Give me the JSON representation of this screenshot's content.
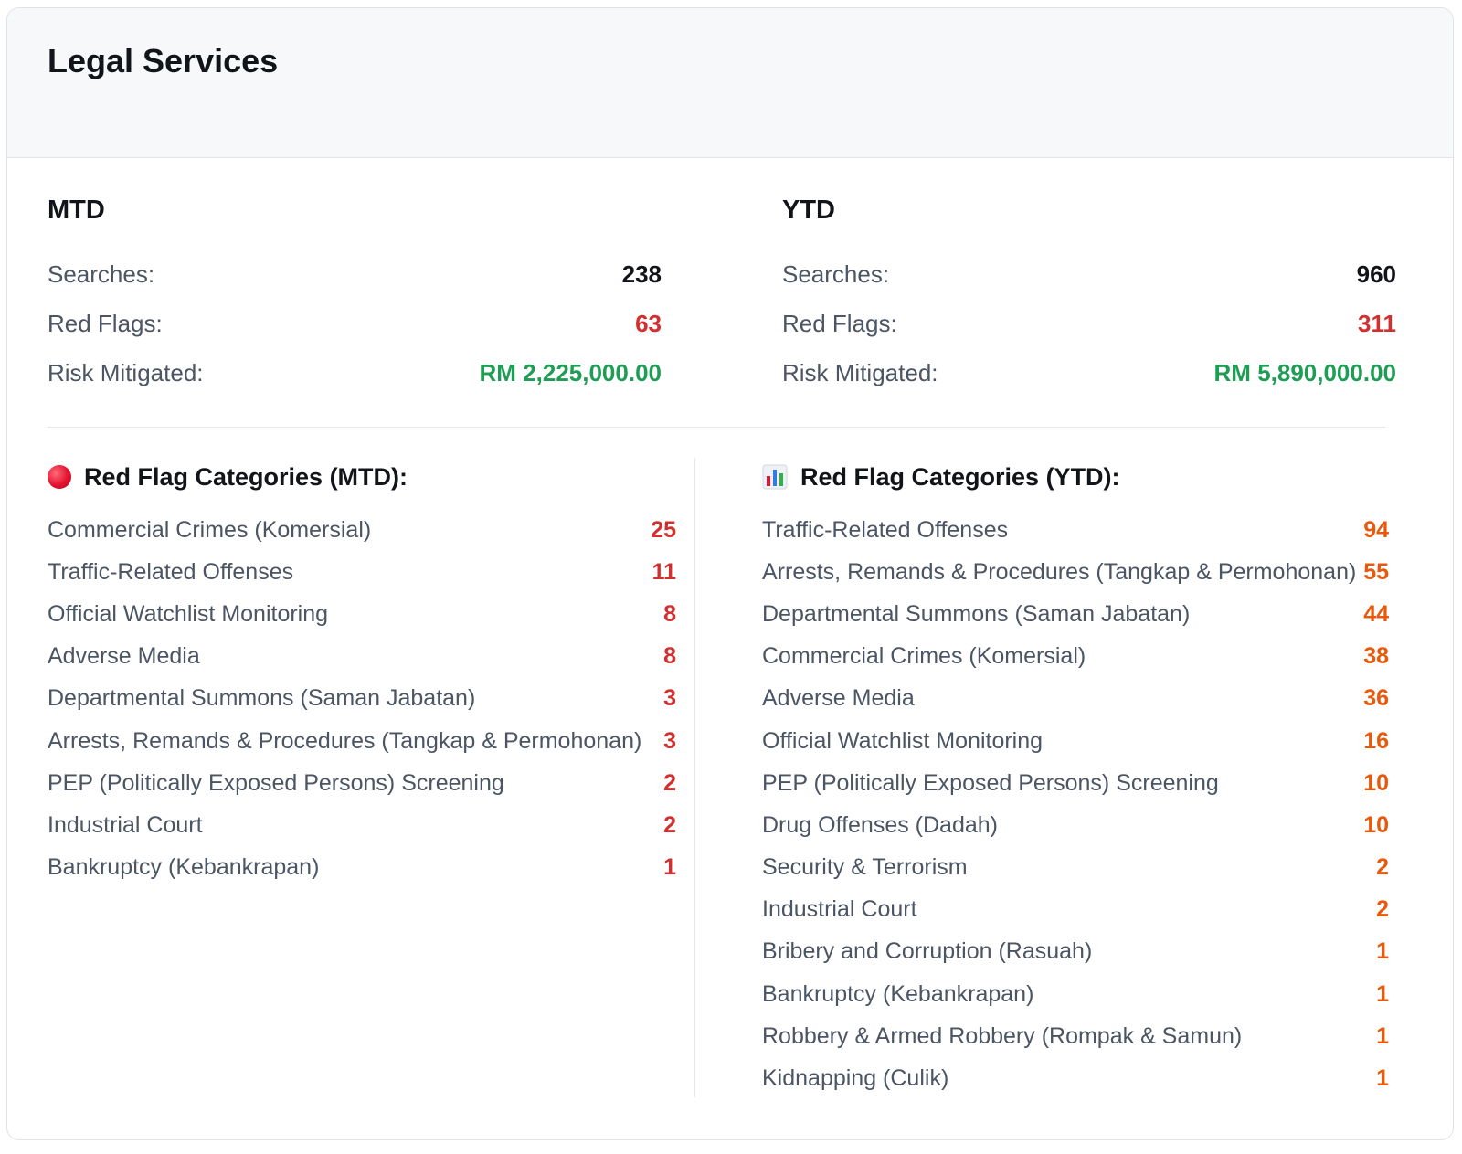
{
  "title": "Legal Services",
  "colors": {
    "red": "#d32f2f",
    "green": "#1f9d55",
    "orange": "#e8590c"
  },
  "mtd": {
    "title": "MTD",
    "searches_label": "Searches:",
    "searches": "238",
    "red_flags_label": "Red Flags:",
    "red_flags": "63",
    "risk_label": "Risk Mitigated:",
    "risk": "RM 2,225,000.00"
  },
  "ytd": {
    "title": "YTD",
    "searches_label": "Searches:",
    "searches": "960",
    "red_flags_label": "Red Flags:",
    "red_flags": "311",
    "risk_label": "Risk Mitigated:",
    "risk": "RM 5,890,000.00"
  },
  "categories_mtd": {
    "heading": "Red Flag Categories (MTD):",
    "icon": "red-circle-icon",
    "items": [
      {
        "label": "Commercial Crimes (Komersial)",
        "count": "25"
      },
      {
        "label": "Traffic-Related Offenses",
        "count": "11"
      },
      {
        "label": "Official Watchlist Monitoring",
        "count": "8"
      },
      {
        "label": "Adverse Media",
        "count": "8"
      },
      {
        "label": "Departmental Summons (Saman Jabatan)",
        "count": "3"
      },
      {
        "label": "Arrests, Remands & Procedures (Tangkap & Permohonan)",
        "count": "3"
      },
      {
        "label": "PEP (Politically Exposed Persons) Screening",
        "count": "2"
      },
      {
        "label": "Industrial Court",
        "count": "2"
      },
      {
        "label": "Bankruptcy (Kebankrapan)",
        "count": "1"
      }
    ]
  },
  "categories_ytd": {
    "heading": "Red Flag Categories (YTD):",
    "icon": "bar-chart-icon",
    "items": [
      {
        "label": "Traffic-Related Offenses",
        "count": "94"
      },
      {
        "label": "Arrests, Remands & Procedures (Tangkap & Permohonan)",
        "count": "55"
      },
      {
        "label": "Departmental Summons (Saman Jabatan)",
        "count": "44"
      },
      {
        "label": "Commercial Crimes (Komersial)",
        "count": "38"
      },
      {
        "label": "Adverse Media",
        "count": "36"
      },
      {
        "label": "Official Watchlist Monitoring",
        "count": "16"
      },
      {
        "label": "PEP (Politically Exposed Persons) Screening",
        "count": "10"
      },
      {
        "label": "Drug Offenses (Dadah)",
        "count": "10"
      },
      {
        "label": "Security & Terrorism",
        "count": "2"
      },
      {
        "label": "Industrial Court",
        "count": "2"
      },
      {
        "label": "Bribery and Corruption (Rasuah)",
        "count": "1"
      },
      {
        "label": "Bankruptcy (Kebankrapan)",
        "count": "1"
      },
      {
        "label": "Robbery & Armed Robbery (Rompak & Samun)",
        "count": "1"
      },
      {
        "label": "Kidnapping (Culik)",
        "count": "1"
      }
    ]
  }
}
